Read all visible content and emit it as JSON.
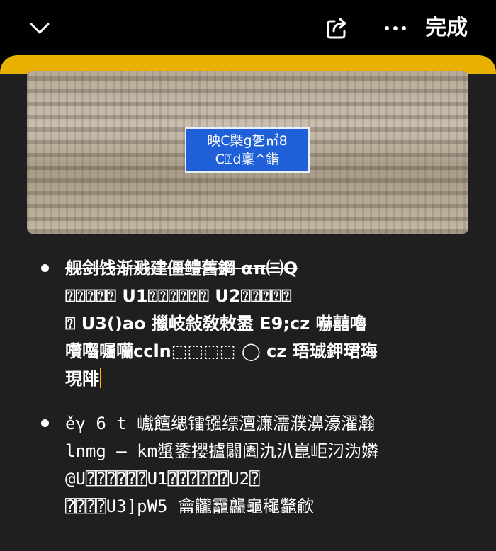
{
  "toolbar": {
    "back_icon": "chevron-down-icon",
    "share_icon": "share-icon",
    "more_icon": "more-icon",
    "done_label": "完成"
  },
  "photo": {
    "sign_line1": "映C槩g乫㎡8",
    "sign_line2": "C⍰d稟^鍇"
  },
  "list": {
    "items": [
      {
        "strikethrough_text": "舰剑饯渐溅建僵鳢舊鋼 απ㈢Q",
        "text": "\n⍰⍰⍰⍰⍰ U1⍰⍰⍰⍰⍰⍰ U2⍰⍰⍰⍰⍰\n⍰ U3()ao 擸岐敍敎敕盝 E9;cz 嚇囍嚕\n嚽囓囑囒ccln⬚⬚⬚⬚ ◯ cz 珸珹鉀珺珻\n現陫"
      },
      {
        "text": "ěγ 6 t 巇饘缌镭镪缥澶濂濡濮濞濠濯瀚\nlnmg – km螿鋈攖攎闢阖氿汃崑岠汈沩嫾\n@U⍰⍰⍰⍰⍰⍰U1⍰⍰⍰⍰⍰⍰U2⍰\n⍰⍰⍰⍰U3]pW5 龠龖龗龘龜龝龞歈"
      }
    ]
  },
  "colors": {
    "note_accent": "#e8b000",
    "sign_blue": "#1f5fd8",
    "cursor": "#ffb000"
  }
}
